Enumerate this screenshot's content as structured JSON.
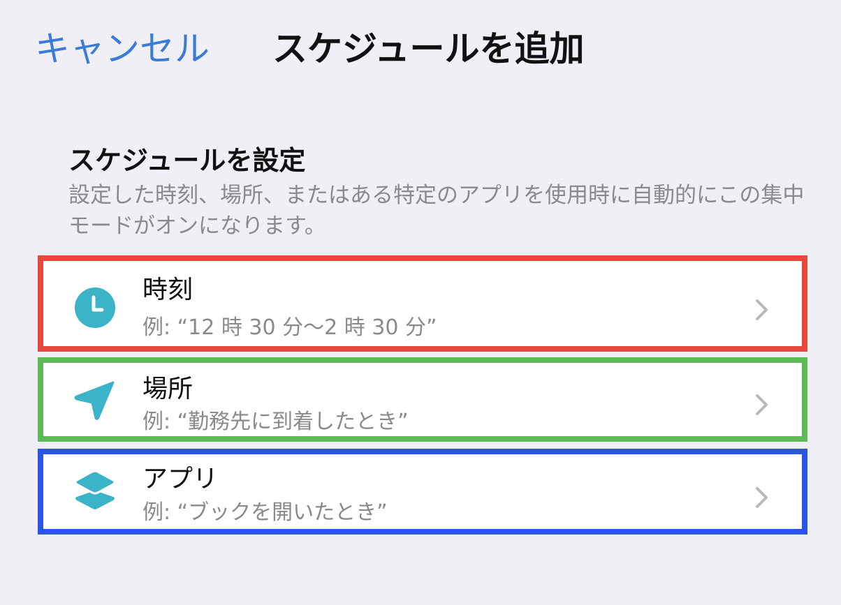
{
  "nav": {
    "cancel_label": "キャンセル",
    "title": "スケジュールを追加"
  },
  "section": {
    "header": "スケジュールを設定",
    "description": "設定した時刻、場所、またはある特定のアプリを使用時に自動的にこの集中モードがオンになります。"
  },
  "rows": [
    {
      "icon": "clock-icon",
      "title": "時刻",
      "subtitle": "例: “12 時 30 分〜2 時 30 分”"
    },
    {
      "icon": "location-arrow-icon",
      "title": "場所",
      "subtitle": "例: “勤務先に到着したとき”"
    },
    {
      "icon": "app-layers-icon",
      "title": "アプリ",
      "subtitle": "例: “ブックを開いたとき”"
    }
  ],
  "colors": {
    "background": "#f0eff5",
    "accent_blue": "#3a7bd5",
    "icon_teal": "#3bb3c9",
    "secondary_text": "#8a8a8e",
    "highlight_red": "#e8483b",
    "highlight_green": "#5cbb56",
    "highlight_blue": "#2b55e6"
  }
}
